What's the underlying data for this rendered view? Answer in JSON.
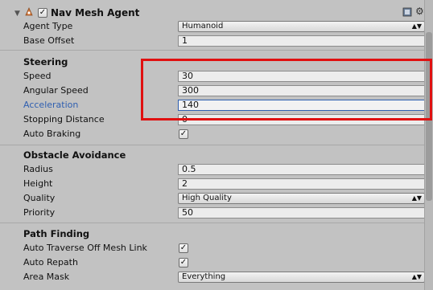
{
  "header": {
    "title": "Nav Mesh Agent",
    "enabled": true
  },
  "fields": {
    "agent_type": {
      "label": "Agent Type",
      "value": "Humanoid"
    },
    "base_offset": {
      "label": "Base Offset",
      "value": "1"
    }
  },
  "steering": {
    "title": "Steering",
    "speed": {
      "label": "Speed",
      "value": "30"
    },
    "angular_speed": {
      "label": "Angular Speed",
      "value": "300"
    },
    "acceleration": {
      "label": "Acceleration",
      "value": "140"
    },
    "stopping_distance": {
      "label": "Stopping Distance",
      "value": "0"
    },
    "auto_braking": {
      "label": "Auto Braking",
      "checked": true
    }
  },
  "obstacle": {
    "title": "Obstacle Avoidance",
    "radius": {
      "label": "Radius",
      "value": "0.5"
    },
    "height": {
      "label": "Height",
      "value": "2"
    },
    "quality": {
      "label": "Quality",
      "value": "High Quality"
    },
    "priority": {
      "label": "Priority",
      "value": "50"
    }
  },
  "path": {
    "title": "Path Finding",
    "auto_traverse": {
      "label": "Auto Traverse Off Mesh Link",
      "checked": true
    },
    "auto_repath": {
      "label": "Auto Repath",
      "checked": true
    },
    "area_mask": {
      "label": "Area Mask",
      "value": "Everything"
    }
  },
  "colors": {
    "highlight": "#2f5fb0",
    "annotation": "#e01010"
  },
  "icons": {
    "foldout": "triangle-down-icon",
    "component": "navmesh-agent-icon",
    "help": "book-icon",
    "settings": "gear-icon"
  }
}
